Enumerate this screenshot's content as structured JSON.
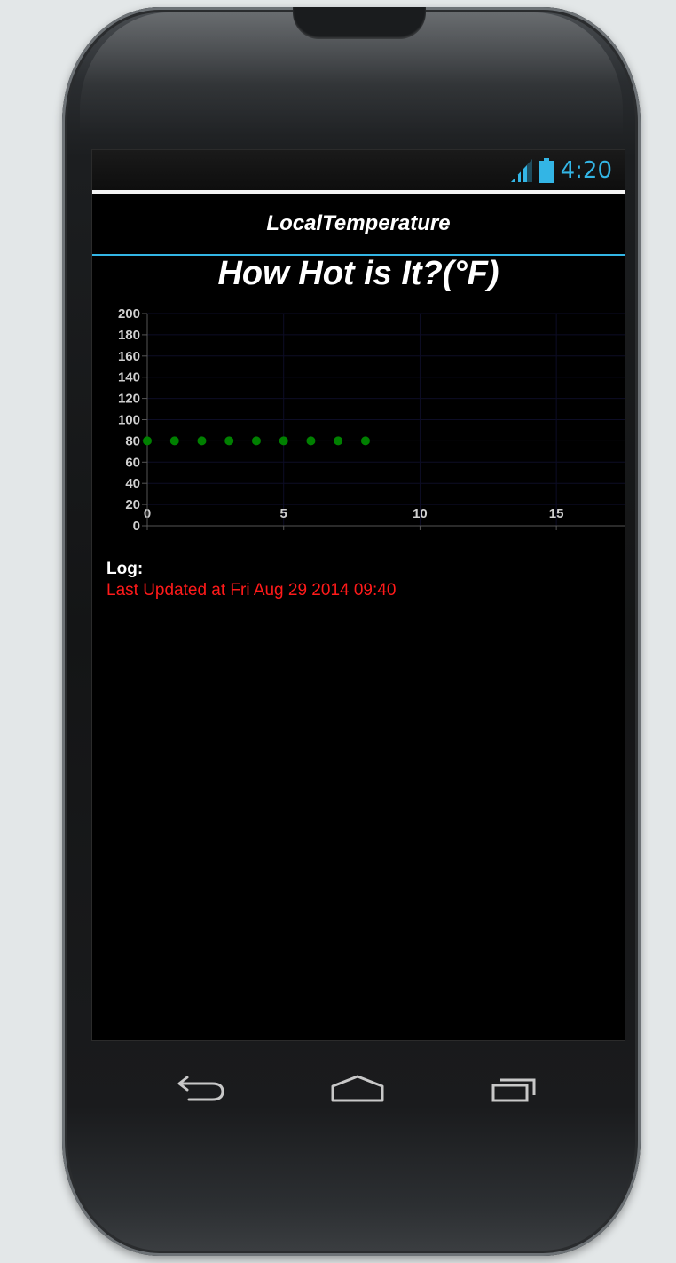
{
  "status_bar": {
    "time": "4:20",
    "signal_icon": "signal-icon",
    "battery_icon": "battery-icon",
    "accent_color": "#33b5e5"
  },
  "action_bar": {
    "title": "LocalTemperature"
  },
  "main": {
    "heading": "How Hot is It?(°F)",
    "log_label": "Log:",
    "log_text": "Last Updated at Fri Aug 29 2014 09:40"
  },
  "navigation": {
    "back_icon": "back-icon",
    "home_icon": "home-icon",
    "recents_icon": "recent-apps-icon"
  },
  "chart_data": {
    "type": "scatter",
    "x": [
      0,
      1,
      2,
      3,
      4,
      5,
      6,
      7,
      8
    ],
    "y": [
      80,
      80,
      80,
      80,
      80,
      80,
      80,
      80,
      80
    ],
    "xlim": [
      0,
      17.5
    ],
    "ylim": [
      0,
      200
    ],
    "x_ticks": [
      0,
      5,
      10,
      15
    ],
    "y_ticks": [
      0,
      20,
      40,
      60,
      80,
      100,
      120,
      140,
      160,
      180,
      200
    ],
    "point_color": "#008000",
    "grid": true
  }
}
